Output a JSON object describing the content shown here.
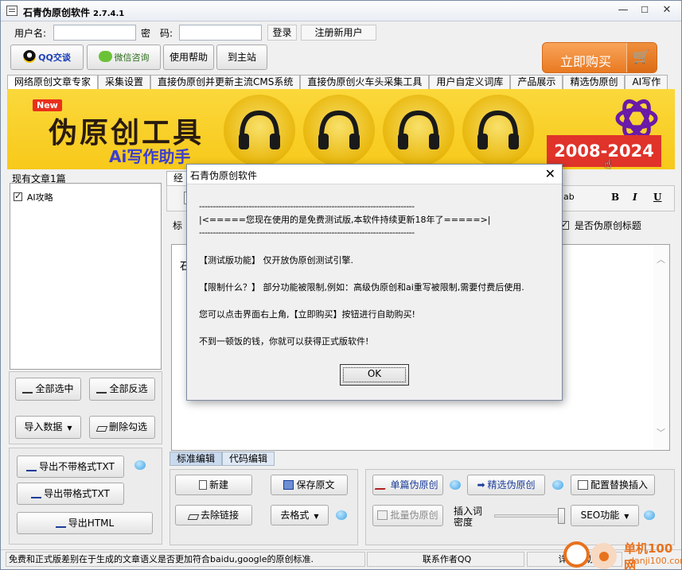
{
  "window": {
    "title": "石青伪原创软件",
    "version": "2.7.4.1",
    "controls": {
      "minimize": "—",
      "maximize": "☐",
      "close": "✕"
    }
  },
  "login": {
    "username_label": "用户名:",
    "password_label": "密　码:",
    "username_value": "",
    "password_value": "",
    "login_button": "登录",
    "register_button": "注册新用户"
  },
  "toolbar": {
    "qq_button": "QQ交谈",
    "wechat_button": "微信咨询",
    "help_button": "使用帮助",
    "site_button": "到主站",
    "buy_button": "立即购买"
  },
  "tabs": [
    {
      "label": "网络原创文章专家",
      "active": true
    },
    {
      "label": "采集设置",
      "active": false
    },
    {
      "label": "直接伪原创并更新主流CMS系统",
      "active": false
    },
    {
      "label": "直接伪原创火车头采集工具",
      "active": false
    },
    {
      "label": "用户自定义词库",
      "active": false
    },
    {
      "label": "产品展示",
      "active": false
    },
    {
      "label": "精选伪原创",
      "active": false
    },
    {
      "label": "AI写作",
      "active": false
    }
  ],
  "banner": {
    "badge": "New",
    "headline": "伪原创工具",
    "subline": "Ai写作助手",
    "years": "2008-2024"
  },
  "left_panel": {
    "header": "现有文章1篇",
    "articles": [
      {
        "label": "AI攻略",
        "checked": true
      }
    ],
    "buttons": {
      "select_all": "全部选中",
      "invert": "全部反选",
      "import": "导入数据",
      "delete_checked": "删除勾选",
      "export_plain": "导出不带格式TXT",
      "export_formatted": "导出带格式TXT",
      "export_html": "导出HTML"
    }
  },
  "right_panel": {
    "tab_fragment": "经",
    "title_label_fragment": "标",
    "editor_fragment": "石",
    "title_checkbox_label": "是否伪原创标题",
    "format_buttons": {
      "bold": "B",
      "italic": "I",
      "underline": "U"
    },
    "subtabs": [
      {
        "label": "标准编辑",
        "active": true
      },
      {
        "label": "代码编辑",
        "active": false
      }
    ],
    "actions": {
      "new": "新建",
      "save": "保存原文",
      "remove_links": "去除链接",
      "remove_format": "去格式",
      "single": "单篇伪原创",
      "select_pseudo": "精选伪原创",
      "batch": "批量伪原创",
      "config_replace": "配置替换插入",
      "density_label_1": "插入词",
      "density_label_2": "密度",
      "seo": "SEO功能"
    },
    "slider_value": 1.0
  },
  "dialog": {
    "title": "石青伪原创软件",
    "rule_top": "------------------------------------------------------------------------------",
    "banner_line": "|<=====您现在使用的是免费测试版,本软件持续更新18年了=====>|",
    "rule_bottom": "------------------------------------------------------------------------------",
    "line1": "【测试版功能】 仅开放伪原创测试引擎.",
    "line2": "【限制什么？】 部分功能被限制,例如：高级伪原创和ai重写被限制,需要付费后使用.",
    "line3": "您可以点击界面右上角,【立即购买】按钮进行自助购买!",
    "line4": "不到一顿饭的钱，你就可以获得正式版软件!",
    "ok_button": "OK"
  },
  "statusbar": {
    "message": "免费和正式版差别在于生成的文章语义是否更加符合baidu,google的原创标准.",
    "contact": "联系作者QQ",
    "help_fragment": "详细帮助"
  },
  "watermark": {
    "text": "单机100网",
    "url": "danji100.com"
  }
}
